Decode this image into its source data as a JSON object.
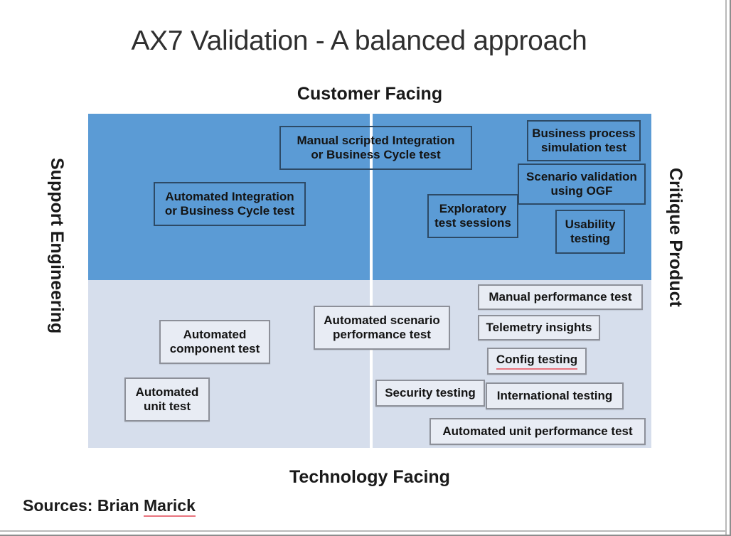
{
  "slide": {
    "title": "AX7 Validation - A balanced approach",
    "sources_label": "Sources:",
    "sources_name": "Brian ",
    "sources_name_flagged": "Marick"
  },
  "axes": {
    "top": "Customer Facing",
    "bottom": "Technology Facing",
    "left": "Support Engineering",
    "right": "Critique Product"
  },
  "colors": {
    "quadrant_top": "#5B9BD5",
    "quadrant_bottom": "#D6DEEC",
    "divider": "#FFFFFF",
    "blue_box_border": "#2D4A66",
    "light_box_fill": "#E8ECF4",
    "light_box_border": "#8D9099",
    "spellcheck_underline": "#E8737D"
  },
  "chart_data": {
    "type": "table",
    "title": "AX7 Validation - A balanced approach",
    "xlabel": "Technology Facing ↔ Customer Facing",
    "ylabel": "Support Engineering ↔ Critique Product",
    "quadrants": [
      {
        "id": "q2-top-left",
        "axis_x": "Technology Facing",
        "axis_y": "Customer Facing / Support Engineering",
        "fill": "#5B9BD5",
        "items": [
          "Automated Integration or Business Cycle test",
          "Manual scripted Integration or Business Cycle test"
        ]
      },
      {
        "id": "q3-top-right",
        "axis_x": "Customer Facing",
        "axis_y": "Critique Product",
        "fill": "#5B9BD5",
        "items": [
          "Business process simulation test",
          "Scenario validation using OGF",
          "Exploratory test sessions",
          "Usability testing"
        ]
      },
      {
        "id": "q1-bottom-left",
        "axis_x": "Technology Facing",
        "axis_y": "Support Engineering",
        "fill": "#D6DEEC",
        "items": [
          "Automated component test",
          "Automated unit test"
        ]
      },
      {
        "id": "q4-bottom-right",
        "axis_x": "Technology Facing",
        "axis_y": "Critique Product",
        "fill": "#D6DEEC",
        "items": [
          "Automated scenario performance test",
          "Manual performance test",
          "Telemetry insights",
          "Config testing",
          "Security testing",
          "International testing",
          "Automated unit performance test"
        ]
      }
    ]
  },
  "nodes": {
    "manual_scripted_l1": "Manual scripted Integration",
    "manual_scripted_l2": "or Business Cycle test",
    "business_process_l1": "Business process",
    "business_process_l2": "simulation test",
    "scenario_validation_l1": "Scenario validation",
    "scenario_validation_l2": "using OGF",
    "automated_integration_l1": "Automated Integration",
    "automated_integration_l2": "or Business Cycle test",
    "exploratory_l1": "Exploratory",
    "exploratory_l2": "test sessions",
    "usability_l1": "Usability",
    "usability_l2": "testing",
    "manual_performance": "Manual performance test",
    "telemetry_insights": "Telemetry insights",
    "automated_scenario_l1": "Automated scenario",
    "automated_scenario_l2": "performance test",
    "config_testing": "Config testing",
    "automated_component_l1": "Automated",
    "automated_component_l2": "component test",
    "security_testing": "Security testing",
    "international_testing": "International testing",
    "automated_unit_l1": "Automated",
    "automated_unit_l2": "unit test",
    "automated_unit_perf": "Automated unit performance test"
  }
}
